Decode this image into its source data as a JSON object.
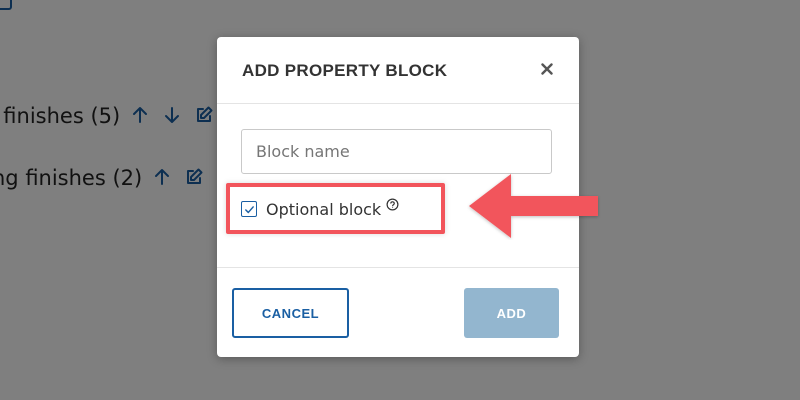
{
  "background": {
    "rows": [
      {
        "label": "r finishes (5)"
      },
      {
        "label": "ng finishes (2)"
      }
    ]
  },
  "modal": {
    "title": "ADD PROPERTY BLOCK",
    "name_input": {
      "value": "",
      "placeholder": "Block name"
    },
    "optional_checkbox": {
      "label": "Optional block",
      "checked": true
    },
    "cancel_label": "CANCEL",
    "add_label": "ADD"
  },
  "annotation": {
    "highlight_color": "#f2545b"
  },
  "colors": {
    "accent": "#1a5fa3",
    "add_disabled": "#93b6cf"
  },
  "icons": {
    "close": "close-icon",
    "help": "question-circle-icon",
    "check": "checkmark-icon",
    "arrow_up": "arrow-up-icon",
    "arrow_down": "arrow-down-icon",
    "edit": "edit-icon",
    "trash": "trash-icon"
  }
}
